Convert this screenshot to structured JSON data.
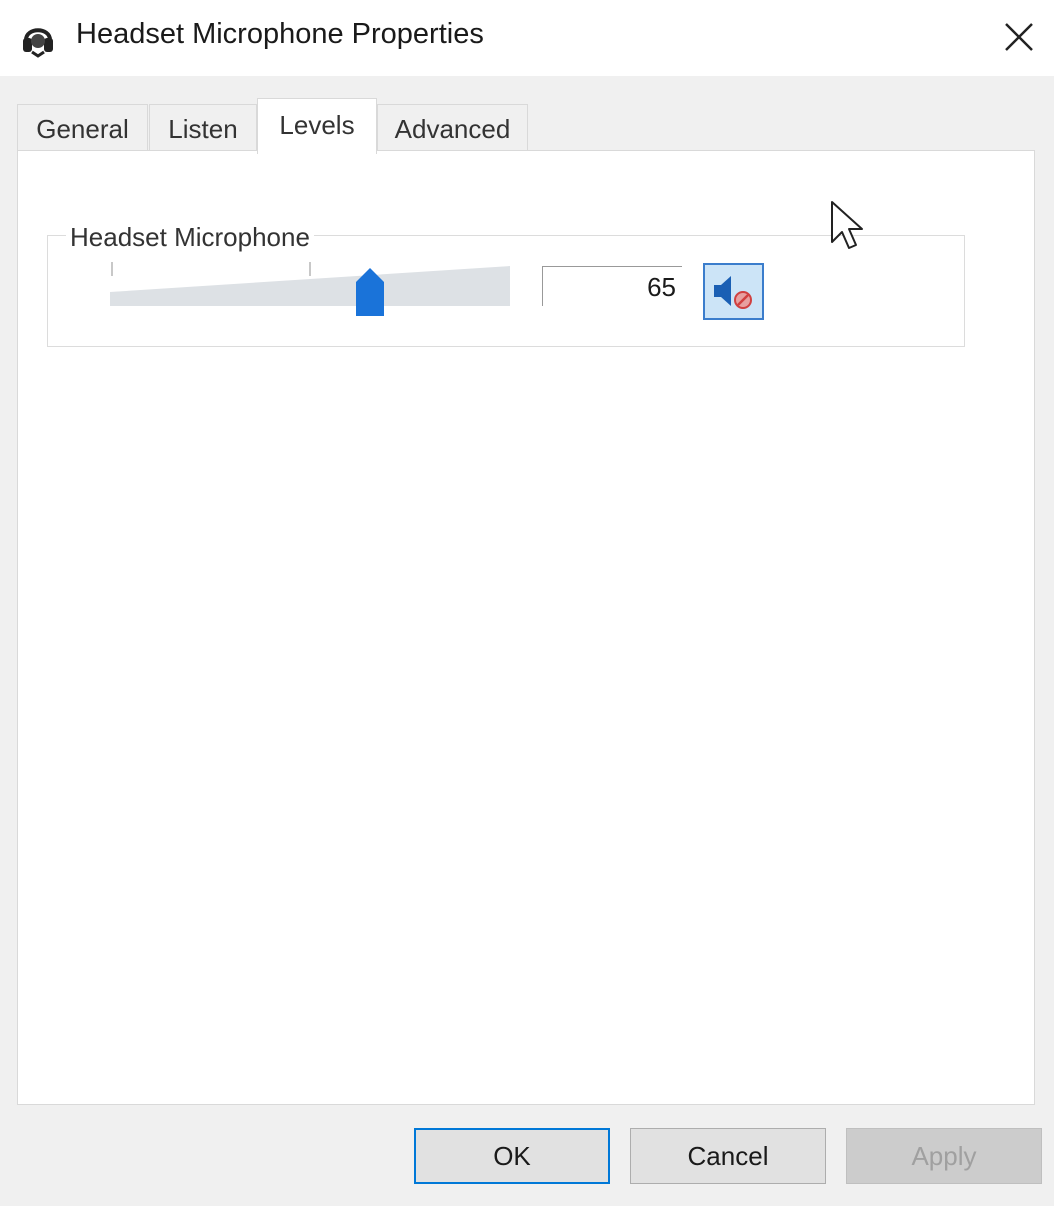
{
  "window": {
    "title": "Headset Microphone Properties",
    "icon": "headset-icon",
    "close_icon": "close-icon"
  },
  "tabs": [
    {
      "label": "General",
      "selected": false
    },
    {
      "label": "Listen",
      "selected": false
    },
    {
      "label": "Levels",
      "selected": true
    },
    {
      "label": "Advanced",
      "selected": false
    }
  ],
  "levels": {
    "group_label": "Headset Microphone",
    "level_value": "65",
    "slider_level_percent": 65,
    "mute_icon": "speaker-muted-icon"
  },
  "buttons": {
    "ok": "OK",
    "cancel": "Cancel",
    "apply": "Apply",
    "apply_enabled": false
  },
  "colors": {
    "accent": "#0078d7",
    "slider_thumb": "#1a73d9",
    "mute_button_bg": "#cce4f7"
  }
}
